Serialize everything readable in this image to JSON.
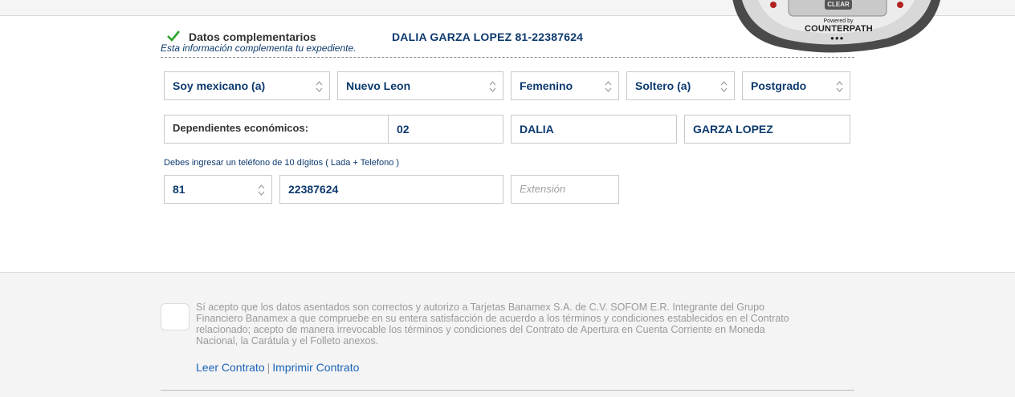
{
  "section": {
    "title": "Datos complementarios",
    "name_phone": "DALIA GARZA LOPEZ 81-22387624",
    "subtitle": "Esta información complementa tu expediente."
  },
  "selects": {
    "nationality": "Soy mexicano (a)",
    "state": "Nuevo Leon",
    "gender": "Femenino",
    "marital_status": "Soltero (a)",
    "education": "Postgrado"
  },
  "dependents": {
    "label": "Dependientes económicos:",
    "value": "02",
    "first_name": "DALIA",
    "last_name": "GARZA LOPEZ"
  },
  "phone": {
    "hint": "Debes ingresar un teléfono de 10 dígitos ( Lada + Telefono )",
    "lada": "81",
    "number": "22387624",
    "extension_placeholder": "Extensión"
  },
  "footer": {
    "accept_text": "Sí acepto que los datos asentados son correctos y autorizo a Tarjetas Banamex S.A. de C.V. SOFOM E.R. Integrante del Grupo Financiero Banamex a que compruebe en su entera satisfacción de acuerdo a los términos y condiciones establecidos en el Contrato relacionado; acepto de manera irrevocable los términos y condiciones del Contrato de Apertura en Cuenta Corriente en Moneda Nacional, la Carátula y el Folleto anexos.",
    "link_read": "Leer Contrato",
    "link_separator": "|",
    "link_print": "Imprimir Contrato"
  },
  "widget": {
    "clear_label": "CLEAR",
    "powered_by": "Powered by",
    "brand": "COUNTERPATH"
  },
  "colors": {
    "accent_blue": "#0d3a6e",
    "link_blue": "#1a64b8",
    "check_green": "#2aa52a"
  }
}
